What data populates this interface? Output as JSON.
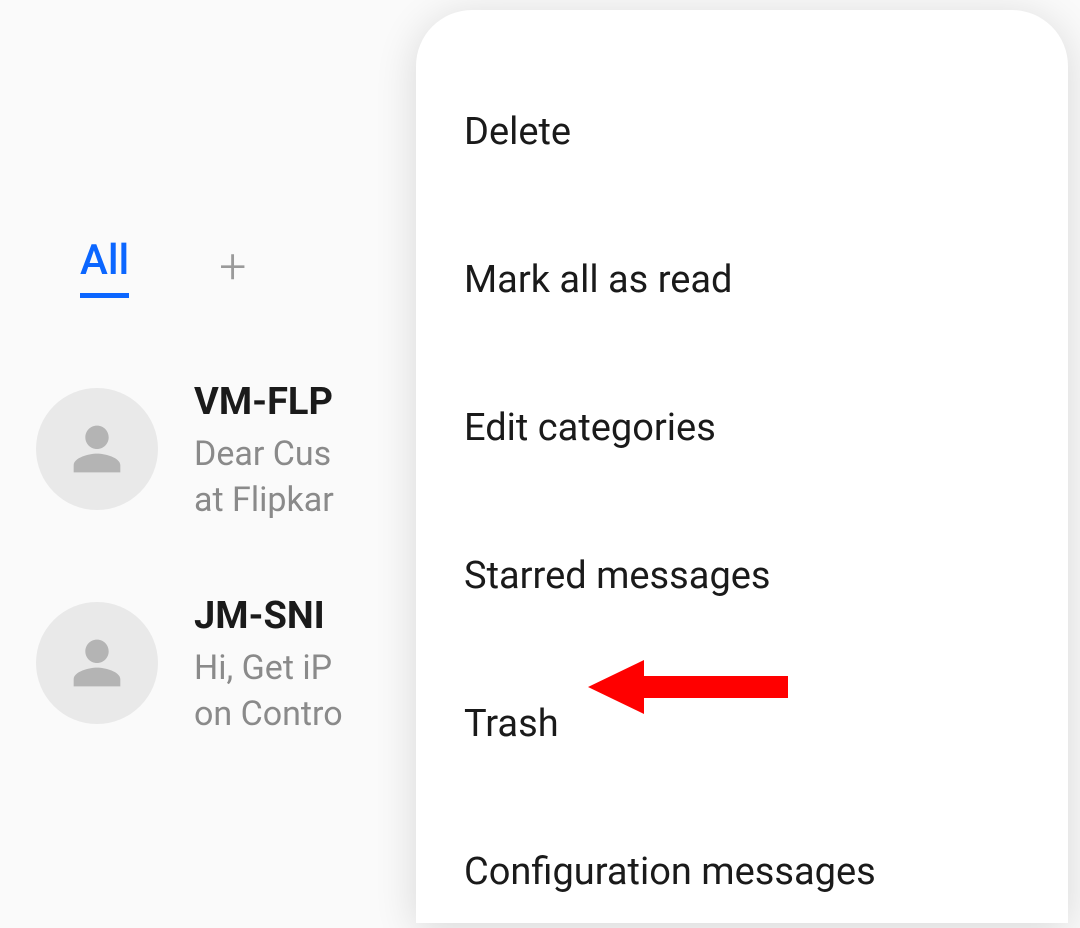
{
  "tabs": {
    "all_label": "All"
  },
  "threads": [
    {
      "title": "VM-FLP",
      "preview": "Dear Cus\nat Flipkar"
    },
    {
      "title": "JM-SNI",
      "preview": "Hi, Get iP\non Contro"
    }
  ],
  "menu": {
    "items": [
      "Delete",
      "Mark all as read",
      "Edit categories",
      "Starred messages",
      "Trash",
      "Configuration messages"
    ]
  }
}
